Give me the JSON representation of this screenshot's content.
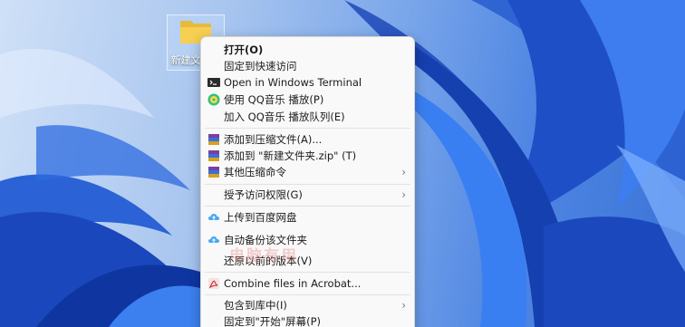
{
  "desktop": {
    "folder_label": "新建文件夹"
  },
  "context_menu": {
    "items": [
      {
        "label": "打开(O)",
        "bold": true
      },
      {
        "label": "固定到快速访问"
      },
      {
        "label": "Open in Windows Terminal",
        "icon": "terminal-icon"
      },
      {
        "label": "使用 QQ音乐 播放(P)",
        "icon": "qq-music-icon"
      },
      {
        "label": "加入 QQ音乐 播放队列(E)"
      },
      {
        "label": "添加到压缩文件(A)...",
        "icon": "winrar-icon"
      },
      {
        "label": "添加到 \"新建文件夹.zip\" (T)",
        "icon": "winrar-icon"
      },
      {
        "label": "其他压缩命令",
        "icon": "winrar-icon",
        "submenu": true
      },
      {
        "label": "授予访问权限(G)",
        "submenu": true
      },
      {
        "label": "上传到百度网盘",
        "icon": "baidu-cloud-icon"
      },
      {
        "label": "自动备份该文件夹",
        "icon": "baidu-cloud-icon"
      },
      {
        "label": "还原以前的版本(V)"
      },
      {
        "label": "Combine files in Acrobat...",
        "icon": "acrobat-icon"
      },
      {
        "label": "包含到库中(I)",
        "submenu": true
      },
      {
        "label": "固定到\"开始\"屏幕(P)"
      }
    ]
  },
  "watermark_text": "电脑有用"
}
